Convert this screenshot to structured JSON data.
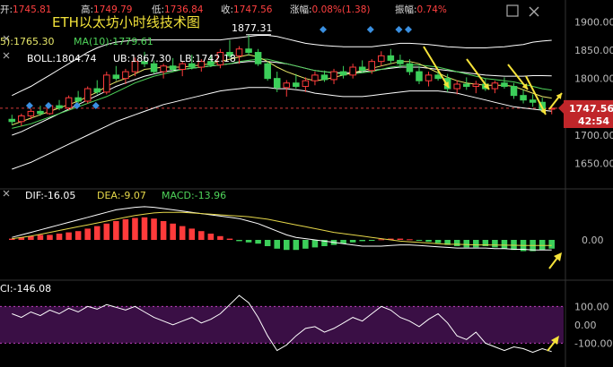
{
  "header": {
    "open_label": "开:",
    "open": "1745.81",
    "high_label": "高:",
    "high": "1749.79",
    "low_label": "低:",
    "low": "1736.84",
    "close_label": "收:",
    "close": "1747.56",
    "change_label": "涨幅:",
    "change": "0.08%(1.38)",
    "amplitude_label": "振幅:",
    "amplitude": "0.74%"
  },
  "title": "ETH以太坊小时线技术图",
  "ma_legend": {
    "ma5": "5):1765.30",
    "ma10": "MA(10):1779.61"
  },
  "boll_legend": {
    "boll": "BOLL:1804.74",
    "ub": "UB:1867.30",
    "lb": "LB:1742.18"
  },
  "high_marker": "1877.31",
  "current_price_tag": "1747.56",
  "countdown_tag": "42:54",
  "macd_legend": {
    "dif": "DIF:-16.05",
    "dea": "DEA:-9.07",
    "macd": "MACD:-13.96"
  },
  "cci_legend": "CI:-146.08",
  "colors": {
    "up": "#ff3b3b",
    "down": "#3ccf5a",
    "ma5": "#e8e86a",
    "ma10": "#4fd45a",
    "boll": "#ffffff",
    "dif": "#ffffff",
    "dea": "#e6d84a",
    "cci": "#ffffff",
    "arrow": "#f5e23a",
    "tag": "#c0262a",
    "cci_band": "#3a0f45",
    "price_line": "#d23a3a"
  },
  "chart_data": [
    {
      "type": "candlestick",
      "title": "ETH以太坊小时线技术图",
      "ylim": [
        1610,
        1910
      ],
      "y_ticks": [
        1650,
        1700,
        1750,
        1800,
        1850,
        1900
      ],
      "y_tick_labels": [
        "1650.00",
        "1700.00",
        "1750.00",
        "1800.00",
        "1850.00",
        "1900.00"
      ],
      "ohlc": [
        [
          1728,
          1736,
          1718,
          1724
        ],
        [
          1724,
          1738,
          1716,
          1734
        ],
        [
          1734,
          1747,
          1728,
          1742
        ],
        [
          1742,
          1752,
          1734,
          1738
        ],
        [
          1738,
          1756,
          1736,
          1752
        ],
        [
          1752,
          1762,
          1744,
          1748
        ],
        [
          1748,
          1770,
          1744,
          1766
        ],
        [
          1766,
          1778,
          1756,
          1760
        ],
        [
          1760,
          1786,
          1756,
          1782
        ],
        [
          1782,
          1797,
          1772,
          1776
        ],
        [
          1776,
          1812,
          1772,
          1806
        ],
        [
          1806,
          1822,
          1796,
          1800
        ],
        [
          1800,
          1817,
          1790,
          1812
        ],
        [
          1812,
          1837,
          1804,
          1830
        ],
        [
          1830,
          1847,
          1820,
          1826
        ],
        [
          1826,
          1832,
          1808,
          1812
        ],
        [
          1812,
          1826,
          1800,
          1822
        ],
        [
          1822,
          1836,
          1812,
          1816
        ],
        [
          1816,
          1830,
          1804,
          1826
        ],
        [
          1826,
          1842,
          1816,
          1820
        ],
        [
          1820,
          1834,
          1812,
          1830
        ],
        [
          1830,
          1842,
          1820,
          1824
        ],
        [
          1824,
          1852,
          1818,
          1846
        ],
        [
          1846,
          1868,
          1836,
          1840
        ],
        [
          1840,
          1857,
          1826,
          1852
        ],
        [
          1852,
          1877.31,
          1840,
          1846
        ],
        [
          1846,
          1852,
          1822,
          1826
        ],
        [
          1826,
          1830,
          1796,
          1800
        ],
        [
          1800,
          1812,
          1776,
          1784
        ],
        [
          1784,
          1797,
          1768,
          1792
        ],
        [
          1792,
          1808,
          1782,
          1786
        ],
        [
          1786,
          1802,
          1776,
          1796
        ],
        [
          1796,
          1812,
          1788,
          1806
        ],
        [
          1806,
          1814,
          1794,
          1798
        ],
        [
          1798,
          1817,
          1790,
          1812
        ],
        [
          1812,
          1822,
          1800,
          1806
        ],
        [
          1806,
          1826,
          1800,
          1820
        ],
        [
          1820,
          1832,
          1810,
          1814
        ],
        [
          1814,
          1834,
          1808,
          1830
        ],
        [
          1830,
          1848,
          1822,
          1840
        ],
        [
          1840,
          1852,
          1826,
          1832
        ],
        [
          1832,
          1842,
          1818,
          1826
        ],
        [
          1826,
          1834,
          1806,
          1812
        ],
        [
          1812,
          1822,
          1790,
          1796
        ],
        [
          1796,
          1812,
          1786,
          1806
        ],
        [
          1806,
          1816,
          1796,
          1800
        ],
        [
          1800,
          1808,
          1776,
          1782
        ],
        [
          1782,
          1797,
          1772,
          1790
        ],
        [
          1790,
          1802,
          1780,
          1786
        ],
        [
          1786,
          1796,
          1774,
          1790
        ],
        [
          1790,
          1800,
          1778,
          1782
        ],
        [
          1782,
          1796,
          1774,
          1792
        ],
        [
          1792,
          1802,
          1782,
          1786
        ],
        [
          1786,
          1792,
          1764,
          1770
        ],
        [
          1770,
          1780,
          1756,
          1762
        ],
        [
          1762,
          1772,
          1750,
          1758
        ],
        [
          1758,
          1766,
          1740,
          1745.81
        ],
        [
          1745.81,
          1749.79,
          1736.84,
          1747.56
        ]
      ],
      "ma5": [
        1718,
        1724,
        1730,
        1736,
        1742,
        1748,
        1754,
        1760,
        1768,
        1776,
        1786,
        1794,
        1800,
        1808,
        1816,
        1818,
        1820,
        1820,
        1820,
        1822,
        1824,
        1826,
        1830,
        1834,
        1838,
        1842,
        1838,
        1830,
        1820,
        1812,
        1806,
        1800,
        1796,
        1798,
        1802,
        1806,
        1810,
        1814,
        1818,
        1822,
        1826,
        1830,
        1830,
        1826,
        1818,
        1810,
        1802,
        1796,
        1792,
        1790,
        1788,
        1788,
        1788,
        1786,
        1780,
        1774,
        1768,
        1765.3
      ],
      "ma10": [
        1712,
        1716,
        1720,
        1726,
        1732,
        1738,
        1744,
        1750,
        1756,
        1762,
        1768,
        1776,
        1784,
        1792,
        1798,
        1804,
        1808,
        1812,
        1816,
        1818,
        1820,
        1822,
        1824,
        1826,
        1830,
        1832,
        1834,
        1834,
        1830,
        1826,
        1822,
        1818,
        1814,
        1812,
        1810,
        1808,
        1808,
        1810,
        1812,
        1816,
        1820,
        1822,
        1824,
        1824,
        1822,
        1820,
        1816,
        1812,
        1808,
        1804,
        1800,
        1798,
        1796,
        1794,
        1790,
        1786,
        1782,
        1779.61
      ],
      "boll_ub": [
        1770,
        1778,
        1786,
        1796,
        1806,
        1816,
        1826,
        1836,
        1846,
        1854,
        1860,
        1864,
        1866,
        1868,
        1868,
        1868,
        1868,
        1868,
        1868,
        1868,
        1868,
        1868,
        1868,
        1870,
        1872,
        1874,
        1876,
        1876,
        1874,
        1870,
        1866,
        1862,
        1860,
        1858,
        1857,
        1856,
        1856,
        1856,
        1856,
        1858,
        1860,
        1862,
        1862,
        1861,
        1860,
        1858,
        1856,
        1855,
        1854,
        1854,
        1854,
        1855,
        1856,
        1858,
        1860,
        1864,
        1866,
        1867.3
      ],
      "boll_mid": [
        1700,
        1706,
        1714,
        1722,
        1730,
        1738,
        1746,
        1754,
        1762,
        1770,
        1778,
        1786,
        1792,
        1798,
        1804,
        1808,
        1812,
        1814,
        1816,
        1818,
        1820,
        1822,
        1824,
        1826,
        1828,
        1830,
        1830,
        1830,
        1828,
        1826,
        1822,
        1818,
        1814,
        1812,
        1810,
        1810,
        1810,
        1812,
        1814,
        1816,
        1818,
        1820,
        1820,
        1820,
        1818,
        1816,
        1814,
        1812,
        1810,
        1808,
        1806,
        1805,
        1804,
        1804,
        1804,
        1805,
        1805,
        1804.74
      ],
      "boll_lb": [
        1640,
        1646,
        1652,
        1660,
        1668,
        1676,
        1684,
        1692,
        1700,
        1708,
        1716,
        1724,
        1730,
        1736,
        1742,
        1748,
        1754,
        1758,
        1762,
        1766,
        1770,
        1774,
        1778,
        1780,
        1782,
        1784,
        1784,
        1784,
        1782,
        1782,
        1780,
        1778,
        1774,
        1772,
        1770,
        1768,
        1768,
        1768,
        1770,
        1772,
        1774,
        1776,
        1778,
        1778,
        1778,
        1778,
        1776,
        1774,
        1770,
        1766,
        1762,
        1758,
        1754,
        1750,
        1748,
        1746,
        1744,
        1742.18
      ],
      "current_price": 1747.56
    },
    {
      "type": "bar",
      "title": "MACD",
      "ylim": [
        -60,
        60
      ],
      "y_tick_labels": [
        "0.00"
      ],
      "macd": [
        2,
        4,
        6,
        8,
        8,
        10,
        12,
        14,
        18,
        22,
        26,
        30,
        33,
        35,
        36,
        34,
        30,
        26,
        22,
        18,
        14,
        10,
        6,
        2,
        -2,
        -4,
        -6,
        -10,
        -14,
        -16,
        -16,
        -14,
        -12,
        -10,
        -8,
        -6,
        -4,
        -2,
        -1,
        1,
        2,
        2,
        1,
        -1,
        -3,
        -5,
        -8,
        -10,
        -12,
        -12,
        -10,
        -12,
        -14,
        -16,
        -18,
        -18,
        -16,
        -13.96
      ],
      "dif": [
        4,
        8,
        12,
        16,
        20,
        24,
        28,
        32,
        36,
        40,
        44,
        48,
        50,
        52,
        53,
        52,
        50,
        48,
        46,
        44,
        42,
        40,
        38,
        36,
        34,
        30,
        26,
        20,
        14,
        8,
        4,
        2,
        0,
        -2,
        -4,
        -6,
        -8,
        -10,
        -10,
        -10,
        -9,
        -8,
        -8,
        -9,
        -10,
        -11,
        -12,
        -13,
        -13,
        -13,
        -13,
        -14,
        -14,
        -15,
        -15,
        -16,
        -16,
        -16.05
      ],
      "dea": [
        2,
        4,
        6,
        9,
        12,
        15,
        18,
        21,
        24,
        27,
        30,
        33,
        36,
        39,
        41,
        43,
        44,
        44,
        44,
        43,
        42,
        41,
        40,
        39,
        38,
        37,
        35,
        33,
        30,
        27,
        24,
        21,
        18,
        15,
        12,
        10,
        8,
        6,
        4,
        2,
        0,
        -2,
        -3,
        -4,
        -5,
        -6,
        -7,
        -7,
        -7.5,
        -8,
        -8,
        -8.2,
        -8.4,
        -8.6,
        -8.8,
        -9,
        -9,
        -9.07
      ]
    },
    {
      "type": "line",
      "title": "CCI",
      "ylim": [
        -220,
        160
      ],
      "y_ticks": [
        100,
        0,
        -100
      ],
      "y_tick_labels": [
        "100.00",
        "0.00",
        "-100.00"
      ],
      "cci": [
        60,
        40,
        70,
        50,
        80,
        60,
        90,
        70,
        100,
        85,
        110,
        95,
        80,
        100,
        70,
        40,
        20,
        0,
        20,
        40,
        10,
        30,
        60,
        110,
        160,
        120,
        40,
        -60,
        -140,
        -110,
        -60,
        -20,
        -10,
        -40,
        -20,
        10,
        40,
        20,
        60,
        100,
        80,
        40,
        20,
        -10,
        30,
        60,
        10,
        -60,
        -80,
        -40,
        -100,
        -120,
        -140,
        -120,
        -130,
        -150,
        -130,
        -146.08
      ]
    }
  ]
}
